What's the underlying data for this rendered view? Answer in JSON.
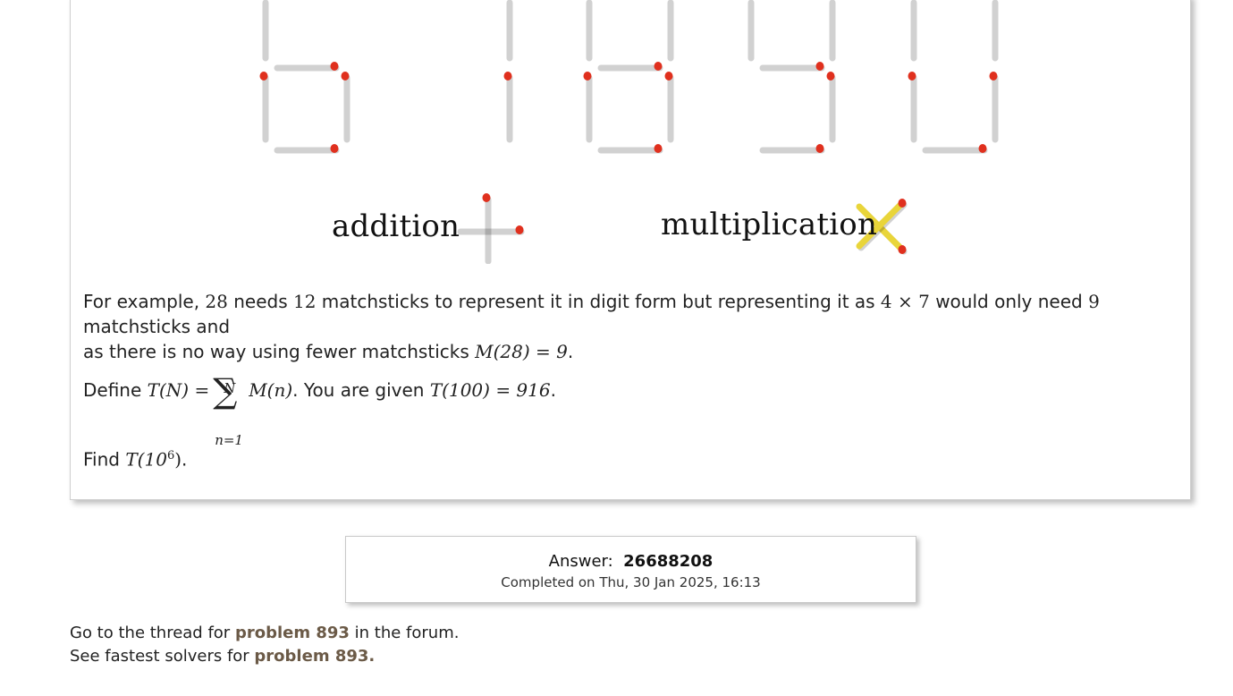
{
  "illustration": {
    "addition_label": "addition",
    "multiplication_label": "multiplication"
  },
  "problem": {
    "p1_prefix": "For example, ",
    "p1_n1": "28",
    "p1_text1": " needs ",
    "p1_n2": "12",
    "p1_text2": " matchsticks to represent it in digit form but representing it as ",
    "p1_expr": "4 × 7",
    "p1_text3": " would only need ",
    "p1_n3": "9",
    "p1_text4": " matchsticks and",
    "p1_line2": "as there is no way using fewer matchsticks ",
    "p1_expr2": "M(28) = 9",
    "p1_end": ".",
    "p2_prefix": "Define ",
    "p2_lhs": "T(N) =",
    "p2_sigma": "∑",
    "p2_upper": "N",
    "p2_lower": "n=1",
    "p2_term": "M(n)",
    "p2_text": ". You are given ",
    "p2_expr": "T(100) = 916",
    "p2_end": ".",
    "p3_prefix": "Find ",
    "p3_expr_base": "T(10",
    "p3_exp": "6",
    "p3_expr_close": ")",
    "p3_end": "."
  },
  "answer": {
    "label": "Answer:",
    "value": "26688208",
    "completed": "Completed on Thu, 30 Jan 2025, 16:13"
  },
  "footer": {
    "line1_prefix": "Go to the thread for ",
    "line1_link": "problem 893",
    "line1_suffix": " in the forum.",
    "line2_prefix": "See fastest solvers for ",
    "line2_link": "problem 893."
  },
  "colors": {
    "stick": "#e9d53a",
    "stick_edge": "#c9b21e",
    "head": "#e0301e",
    "link": "#6b5a47"
  }
}
